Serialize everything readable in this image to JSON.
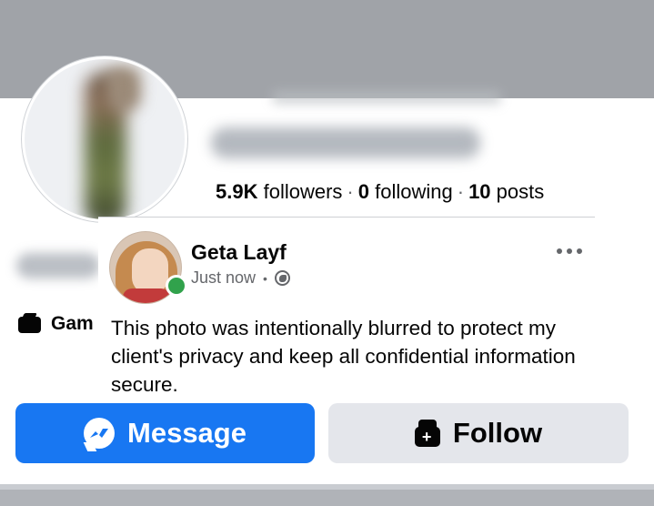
{
  "profile": {
    "stats": {
      "followers_count": "5.9K",
      "followers_label": "followers",
      "following_count": "0",
      "following_label": "following",
      "posts_count": "10",
      "posts_label": "posts",
      "separator": "·"
    },
    "intro": {
      "game_label": "Gam"
    }
  },
  "post": {
    "author": "Geta Layf",
    "time": "Just now",
    "meta_separator": "•",
    "privacy_icon": "globe-icon",
    "more_icon": "more-horizontal-icon",
    "text": "This photo was intentionally blurred to protect my client's privacy and keep all confidential information secure."
  },
  "actions": {
    "message_label": "Message",
    "message_icon": "messenger-icon",
    "follow_label": "Follow",
    "follow_icon": "follow-icon"
  },
  "colors": {
    "primary": "#1877f2",
    "secondary_button": "#e4e6eb",
    "online": "#31a24c",
    "muted_text": "#65676b"
  }
}
